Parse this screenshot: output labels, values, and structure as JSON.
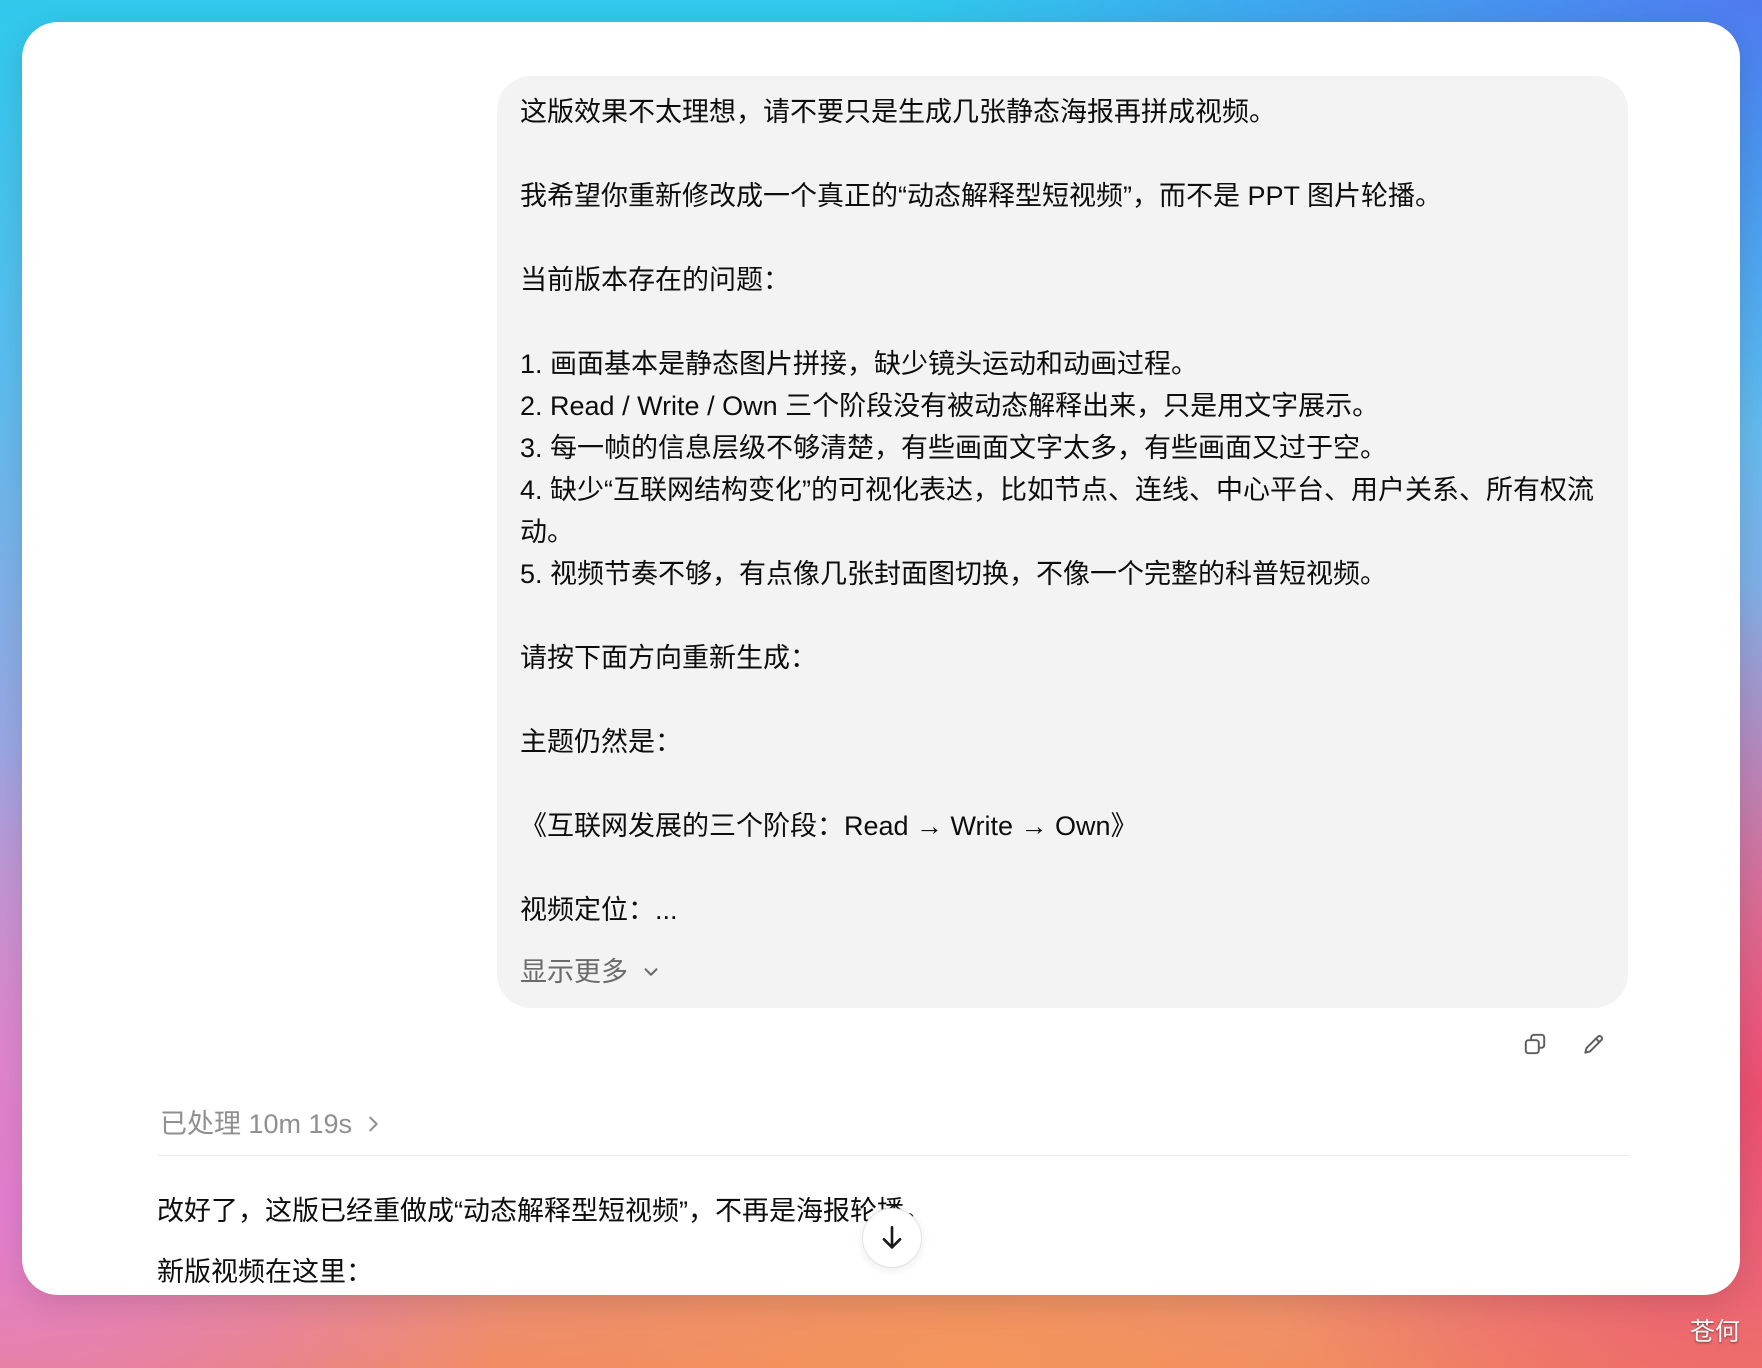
{
  "colors": {
    "window_background": "#ffffff",
    "bubble_background": "#f3f3f3",
    "text_primary": "#0d0d0d",
    "text_secondary": "#8f8f8f",
    "divider": "#ececec"
  },
  "user_message": {
    "paragraphs_top": [
      "这版效果不太理想，请不要只是生成几张静态海报再拼成视频。",
      "我希望你重新修改成一个真正的“动态解释型短视频”，而不是 PPT 图片轮播。",
      "当前版本存在的问题："
    ],
    "issues": [
      "1. 画面基本是静态图片拼接，缺少镜头运动和动画过程。",
      "2. Read / Write / Own 三个阶段没有被动态解释出来，只是用文字展示。",
      "3. 每一帧的信息层级不够清楚，有些画面文字太多，有些画面又过于空。",
      "4. 缺少“互联网结构变化”的可视化表达，比如节点、连线、中心平台、用户关系、所有权流动。",
      "5. 视频节奏不够，有点像几张封面图切换，不像一个完整的科普短视频。"
    ],
    "paragraphs_bottom": [
      "请按下面方向重新生成：",
      "主题仍然是：",
      "《互联网发展的三个阶段：Read → Write → Own》",
      "视频定位：..."
    ],
    "show_more": {
      "label": "显示更多",
      "icon": "chevron-down-icon"
    }
  },
  "message_actions": {
    "copy_icon": "copy-icon",
    "edit_icon": "pencil-icon"
  },
  "assistant_message": {
    "processed": {
      "label": "已处理 10m 19s",
      "icon": "chevron-right-icon"
    },
    "lines": [
      "改好了，这版已经重做成“动态解释型短视频”，不再是海报轮播。",
      "新版视频在这里："
    ]
  },
  "scroll_to_bottom": {
    "icon": "arrow-down-icon"
  },
  "watermark": "苍何"
}
